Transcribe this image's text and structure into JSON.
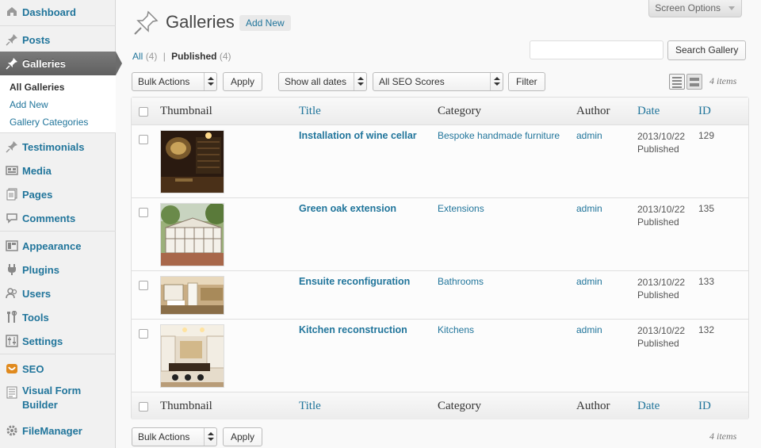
{
  "sidebar": {
    "items": [
      {
        "label": "Dashboard",
        "icon": "dashboard-icon"
      },
      {
        "label": "Posts",
        "icon": "pin-icon"
      },
      {
        "label": "Galleries",
        "icon": "pin-icon"
      },
      {
        "label": "Testimonials",
        "icon": "pin-icon"
      },
      {
        "label": "Media",
        "icon": "media-icon"
      },
      {
        "label": "Pages",
        "icon": "pages-icon"
      },
      {
        "label": "Comments",
        "icon": "comments-icon"
      },
      {
        "label": "Appearance",
        "icon": "appearance-icon"
      },
      {
        "label": "Plugins",
        "icon": "plugins-icon"
      },
      {
        "label": "Users",
        "icon": "users-icon"
      },
      {
        "label": "Tools",
        "icon": "tools-icon"
      },
      {
        "label": "Settings",
        "icon": "settings-icon"
      },
      {
        "label": "SEO",
        "icon": "seo-icon"
      },
      {
        "label": "Visual Form Builder",
        "icon": "form-builder-icon"
      },
      {
        "label": "FileManager",
        "icon": "gear-icon"
      }
    ],
    "submenu": [
      {
        "label": "All Galleries"
      },
      {
        "label": "Add New"
      },
      {
        "label": "Gallery Categories"
      }
    ]
  },
  "header": {
    "screen_options": "Screen Options",
    "title": "Galleries",
    "add_new": "Add New"
  },
  "filters": {
    "all_label": "All",
    "all_count": "(4)",
    "separator": "|",
    "published_label": "Published",
    "published_count": "(4)"
  },
  "search": {
    "placeholder": "",
    "button": "Search Gallery"
  },
  "toolbar": {
    "bulk_actions": "Bulk Actions",
    "apply": "Apply",
    "dates": "Show all dates",
    "seo_scores": "All SEO Scores",
    "filter": "Filter",
    "items_count": "4 items"
  },
  "table": {
    "columns": [
      "Thumbnail",
      "Title",
      "Category",
      "Author",
      "Date",
      "ID"
    ],
    "rows": [
      {
        "title": "Installation of wine cellar",
        "category": "Bespoke handmade furniture",
        "author": "admin",
        "date": "2013/10/22",
        "status": "Published",
        "id": "129"
      },
      {
        "title": "Green oak extension",
        "category": "Extensions",
        "author": "admin",
        "date": "2013/10/22",
        "status": "Published",
        "id": "135"
      },
      {
        "title": "Ensuite reconfiguration",
        "category": "Bathrooms",
        "author": "admin",
        "date": "2013/10/22",
        "status": "Published",
        "id": "133"
      },
      {
        "title": "Kitchen reconstruction",
        "category": "Kitchens",
        "author": "admin",
        "date": "2013/10/22",
        "status": "Published",
        "id": "132"
      }
    ]
  },
  "bottom_toolbar": {
    "bulk_actions": "Bulk Actions",
    "apply": "Apply",
    "items_count": "4 items"
  },
  "colors": {
    "link": "#21759b",
    "active_menu": "#6c6c6c",
    "seo_orange": "#e08a1e"
  }
}
